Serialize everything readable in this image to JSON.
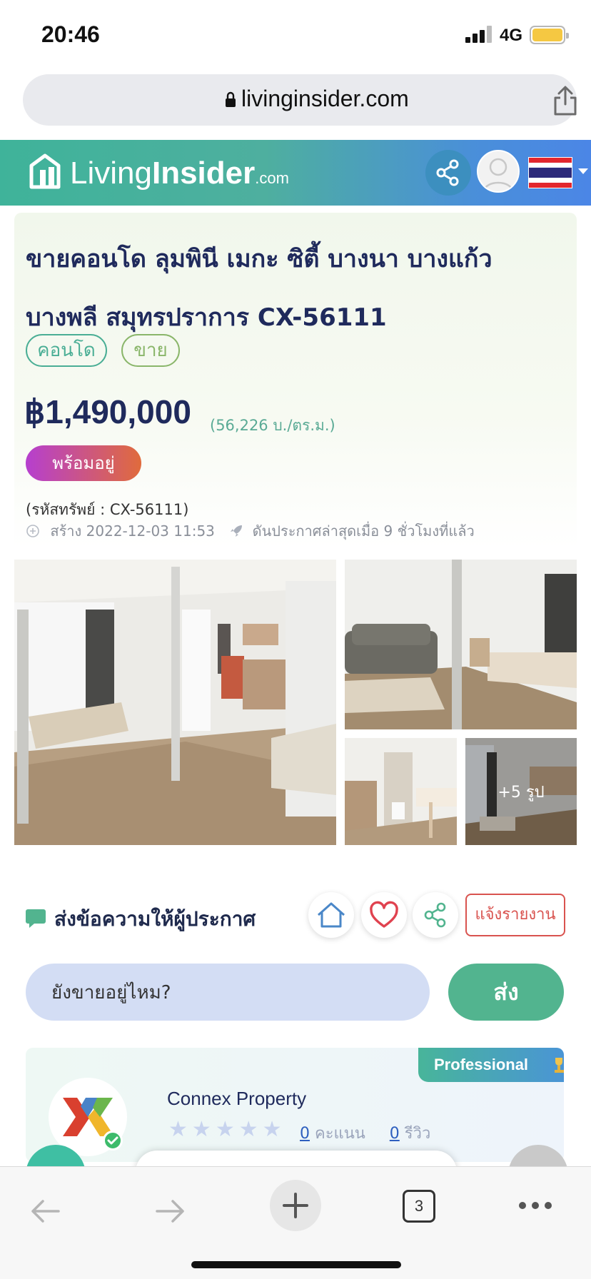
{
  "status_bar": {
    "time": "20:46",
    "network": "4G"
  },
  "browser": {
    "url": "livinginsider.com",
    "tab_count": "3"
  },
  "site": {
    "logo_light": "Living",
    "logo_bold": "Insider",
    "logo_com": ".com"
  },
  "listing": {
    "title_line1": "ขายคอนโด ลุมพินี เมกะ ซิตี้ บางนา บางแก้ว",
    "title_line2": "บางพลี สมุทรปราการ CX-56111",
    "tags": [
      "คอนโด",
      "ขาย"
    ],
    "price": "฿1,490,000",
    "price_per_sqm": "(56,226 บ./ตร.ม.)",
    "status_badge": "พร้อมอยู่",
    "property_code": "(รหัสทรัพย์ : CX-56111)",
    "created": "สร้าง 2022-12-03 11:53",
    "boosted": "ดันประกาศล่าสุดเมื่อ 9 ชั่วโมงที่แล้ว",
    "more_photos": "+5 รูป"
  },
  "message": {
    "heading": "ส่งข้อความให้ผู้ประกาศ",
    "report_label": "แจ้งรายงาน",
    "input_value": "ยังขายอยู่ไหม?",
    "send_label": "ส่ง"
  },
  "agent": {
    "badge": "Professional",
    "name": "Connex Property",
    "rating_count": "0",
    "rating_label": "คะแนน",
    "review_count": "0",
    "review_label": "รีวิว"
  },
  "colors": {
    "header_start": "#3fb39a",
    "header_end": "#4b86e6",
    "primary_text": "#1f2a5c",
    "send_button": "#52b48f",
    "report": "#d9534f"
  }
}
